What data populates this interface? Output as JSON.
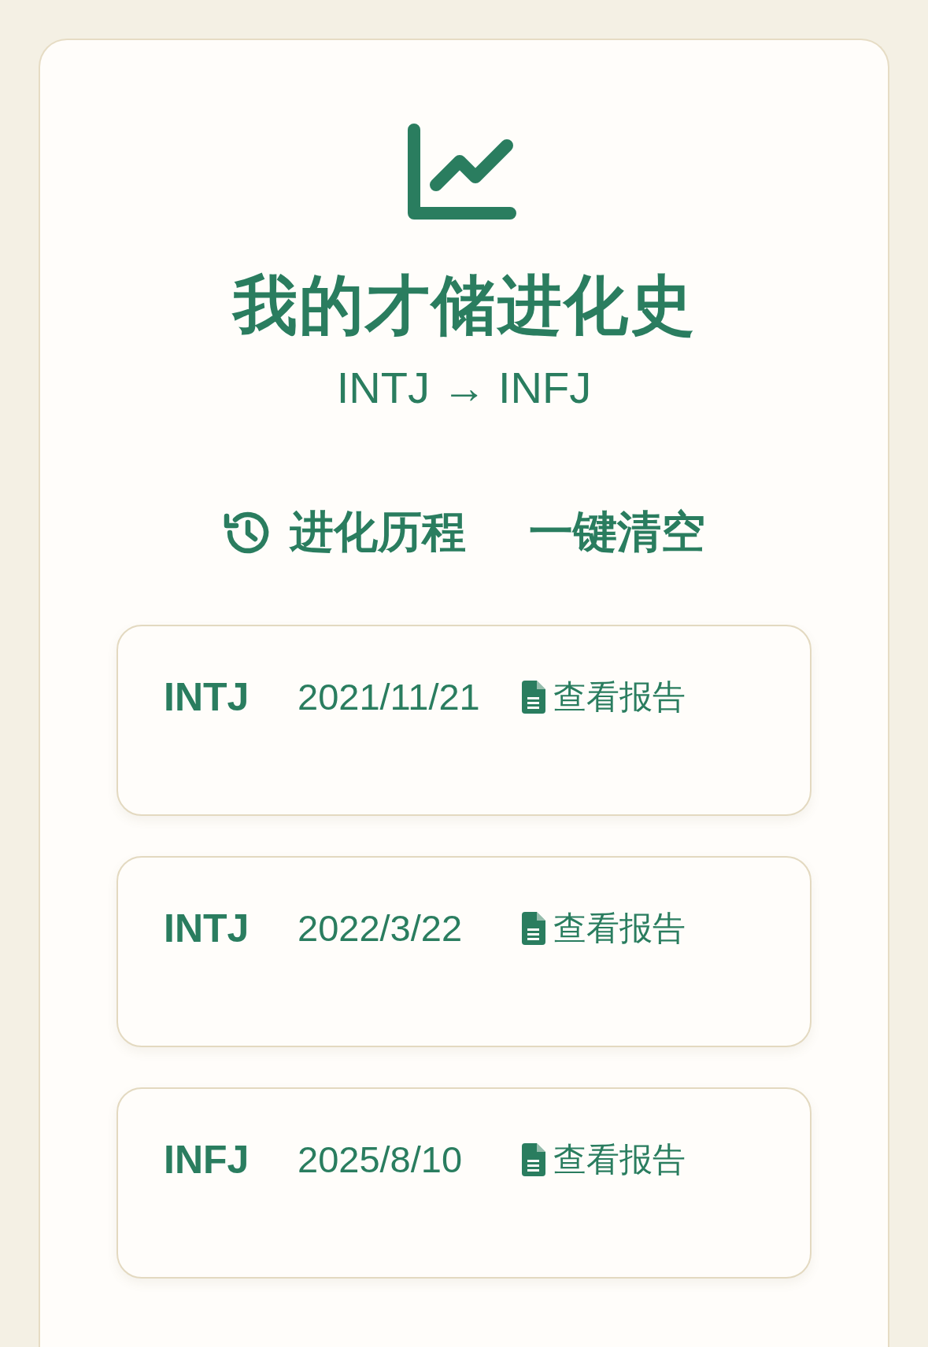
{
  "header": {
    "title": "我的才储进化史",
    "subtitle": "INTJ → INFJ"
  },
  "history": {
    "heading": "进化历程",
    "clear_button": "一键清空"
  },
  "records": [
    {
      "type": "INTJ",
      "date": "2021/11/21",
      "link": "查看报告"
    },
    {
      "type": "INTJ",
      "date": "2022/3/22",
      "link": "查看报告"
    },
    {
      "type": "INFJ",
      "date": "2025/8/10",
      "link": "查看报告"
    }
  ]
}
